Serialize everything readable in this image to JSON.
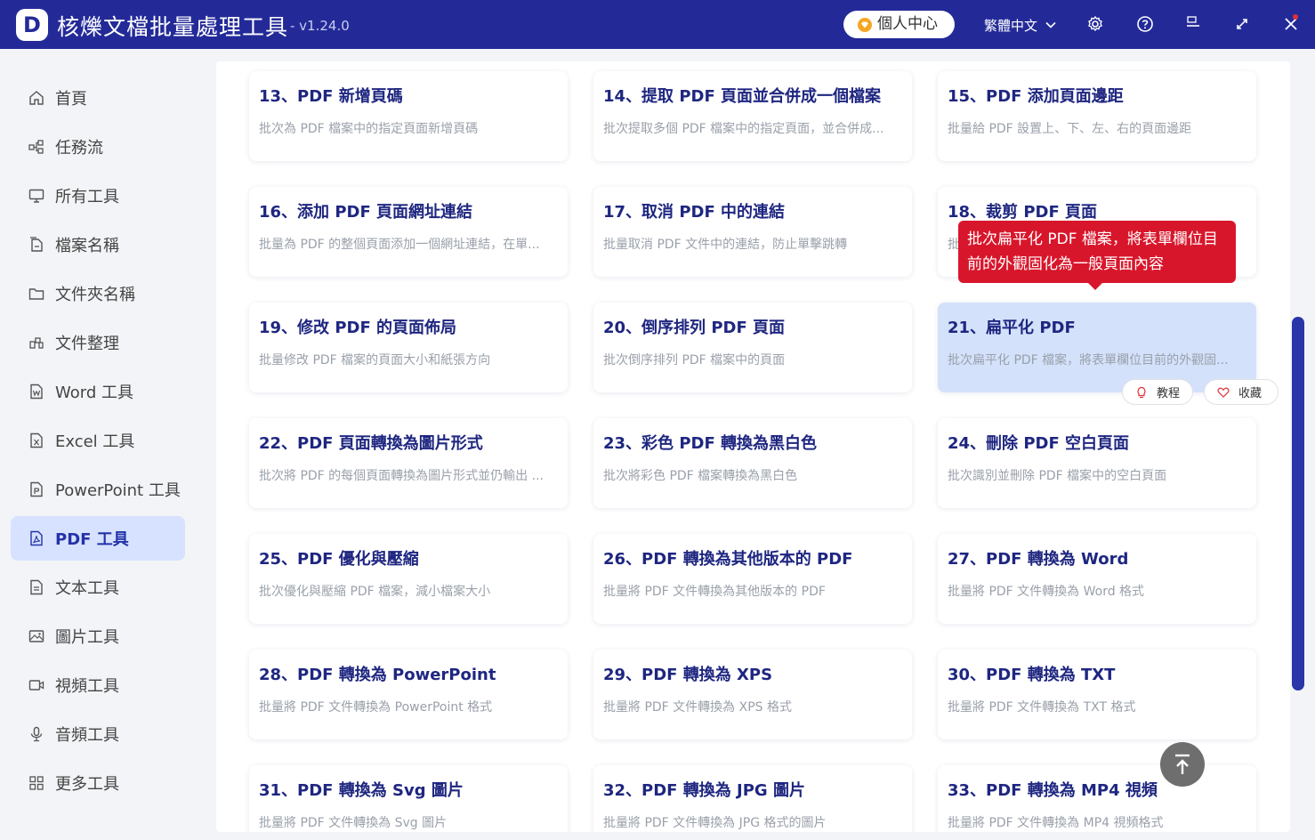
{
  "app": {
    "logo_letter": "D",
    "title": "核爍文檔批量處理工具",
    "version": "- v1.24.0",
    "user_center": "個人中心",
    "language": "繁體中文",
    "accent_color": "#232a98"
  },
  "sidebar": {
    "items": [
      {
        "label": "首頁",
        "icon": "home-icon"
      },
      {
        "label": "任務流",
        "icon": "workflow-icon"
      },
      {
        "label": "所有工具",
        "icon": "monitor-icon"
      },
      {
        "label": "檔案名稱",
        "icon": "file-name-icon"
      },
      {
        "label": "文件夾名稱",
        "icon": "folder-icon"
      },
      {
        "label": "文件整理",
        "icon": "organize-icon"
      },
      {
        "label": "Word 工具",
        "icon": "word-icon"
      },
      {
        "label": "Excel 工具",
        "icon": "excel-icon"
      },
      {
        "label": "PowerPoint 工具",
        "icon": "powerpoint-icon"
      },
      {
        "label": "PDF 工具",
        "icon": "pdf-icon",
        "active": true
      },
      {
        "label": "文本工具",
        "icon": "text-icon"
      },
      {
        "label": "圖片工具",
        "icon": "image-icon"
      },
      {
        "label": "視頻工具",
        "icon": "video-icon"
      },
      {
        "label": "音頻工具",
        "icon": "audio-icon"
      },
      {
        "label": "更多工具",
        "icon": "grid-icon"
      }
    ]
  },
  "tools": [
    {
      "title": "13、PDF 新增頁碼",
      "desc": "批次為 PDF 檔案中的指定頁面新增頁碼"
    },
    {
      "title": "14、提取 PDF 頁面並合併成一個檔案",
      "desc": "批次提取多個 PDF 檔案中的指定頁面，並合併成..."
    },
    {
      "title": "15、PDF 添加頁面邊距",
      "desc": "批量給 PDF 設置上、下、左、右的頁面邊距"
    },
    {
      "title": "16、添加 PDF 頁面網址連結",
      "desc": "批量為 PDF 的整個頁面添加一個網址連結，在單..."
    },
    {
      "title": "17、取消 PDF 中的連結",
      "desc": "批量取消 PDF 文件中的連結，防止單擊跳轉"
    },
    {
      "title": "18、裁剪 PDF 頁面",
      "desc": "批"
    },
    {
      "title": "19、修改 PDF 的頁面佈局",
      "desc": "批量修改 PDF 檔案的頁面大小和紙張方向"
    },
    {
      "title": "20、倒序排列 PDF 頁面",
      "desc": "批次倒序排列 PDF 檔案中的頁面"
    },
    {
      "title": "21、扁平化 PDF",
      "desc": "批次扁平化 PDF 檔案，將表單欄位目前的外觀固..."
    },
    {
      "title": "22、PDF 頁面轉換為圖片形式",
      "desc": "批次將 PDF 的每個頁面轉換為圖片形式並仍輸出 ..."
    },
    {
      "title": "23、彩色 PDF 轉換為黑白色",
      "desc": "批次將彩色 PDF 檔案轉換為黑白色"
    },
    {
      "title": "24、刪除 PDF 空白頁面",
      "desc": "批次識別並刪除 PDF 檔案中的空白頁面"
    },
    {
      "title": "25、PDF 優化與壓縮",
      "desc": "批次優化與壓縮 PDF 檔案，減小檔案大小"
    },
    {
      "title": "26、PDF 轉換為其他版本的 PDF",
      "desc": "批量將 PDF 文件轉換為其他版本的 PDF"
    },
    {
      "title": "27、PDF 轉換為 Word",
      "desc": "批量將 PDF 文件轉換為 Word 格式"
    },
    {
      "title": "28、PDF 轉換為 PowerPoint",
      "desc": "批量將 PDF 文件轉換為 PowerPoint 格式"
    },
    {
      "title": "29、PDF 轉換為 XPS",
      "desc": "批量將 PDF 文件轉換為 XPS 格式"
    },
    {
      "title": "30、PDF 轉換為 TXT",
      "desc": "批量將 PDF 文件轉換為 TXT 格式"
    },
    {
      "title": "31、PDF 轉換為 Svg 圖片",
      "desc": "批量將 PDF 文件轉換為 Svg 圖片"
    },
    {
      "title": "32、PDF 轉換為 JPG 圖片",
      "desc": "批量將 PDF 文件轉換為 JPG 格式的圖片"
    },
    {
      "title": "33、PDF 轉換為 MP4 視頻",
      "desc": "批量將 PDF 文件轉換為 MP4 視頻格式"
    }
  ],
  "hover_card": {
    "tutorial_label": "教程",
    "favorite_label": "收藏",
    "tooltip": "批次扁平化 PDF 檔案，將表單欄位目前的外觀固化為一般頁面內容"
  }
}
